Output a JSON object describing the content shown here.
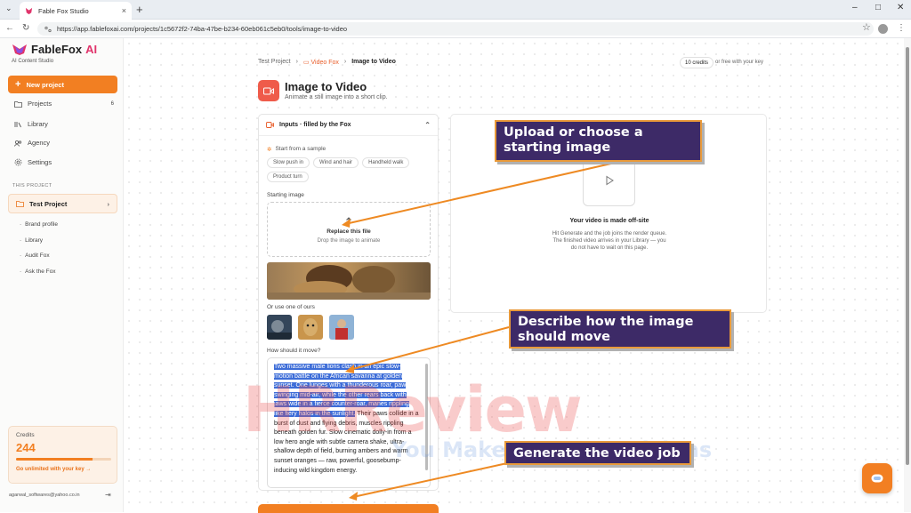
{
  "browser": {
    "tab_title": "Fable Fox Studio",
    "tab_close": "×",
    "new_tab": "+",
    "tab_list": "⌄",
    "url": "https://app.fablefoxai.com/projects/1c5672f2-74ba-47be-b234-60eb061c5eb0/tools/image-to-video",
    "min": "–",
    "max": "□",
    "close": "✕"
  },
  "sidebar": {
    "logo": "FableFox",
    "logo_ai": "AI",
    "logo_sub": "AI Content Studio",
    "new_project": "New project",
    "nav": [
      {
        "label": "Projects",
        "count": "6"
      },
      {
        "label": "Library"
      },
      {
        "label": "Agency"
      },
      {
        "label": "Settings"
      }
    ],
    "section_label": "THIS PROJECT",
    "project_name": "Test Project",
    "project_items": [
      "Brand profile",
      "Library",
      "Audit Fox",
      "Ask the Fox"
    ],
    "credits": {
      "label": "Credits",
      "value": "244",
      "fill_fraction": 0.8,
      "link": "Go unlimited with your key →"
    },
    "email": "agarwal_softwares@yahoo.co.in"
  },
  "main": {
    "breadcrumbs": [
      "Test Project",
      "Video Fox",
      "Image to Video"
    ],
    "crumb_sep": "›",
    "credits_badge": "10 credits",
    "free_key": "or free with your key",
    "title": "Image to Video",
    "subtitle": "Animate a still image into a short clip."
  },
  "inputs": {
    "header": "Inputs · filled by the Fox",
    "sample_label": "Start from a sample",
    "samples": [
      "Slow push in",
      "Wind and hair",
      "Handheld walk",
      "Product turn"
    ],
    "starting_image_label": "Starting image",
    "replace_title": "Replace this file",
    "replace_sub": "Drop the image to animate",
    "use_ours_label": "Or use one of ours",
    "move_label": "How should it move?",
    "prompt_selected": "Two massive male lions clash in an epic slow-motion battle on the African savanna at golden sunset. One lunges with a thunderous roar, paw swinging mid-air, while the other rears back with jaws wide in a fierce counter-roar, manes rippling like fiery halos in the sunlight.",
    "prompt_rest": " Their paws collide in a burst of dust and flying debris, muscles rippling beneath golden fur. Slow cinematic dolly-in from a low hero angle with subtle camera shake, ultra-shallow depth of field, burning ambers and warm sunset oranges — raw, powerful, goosebump-inducing wild kingdom energy."
  },
  "video": {
    "title": "Your video is made off-site",
    "desc": "Hit Generate and the job joins the render queue. The finished video arrives in your Library — you do not have to wait on this page."
  },
  "callouts": {
    "upload": "Upload or choose a starting image",
    "describe": "Describe how the image should move",
    "generate": "Generate the video job"
  },
  "watermark": {
    "main": "HRReview",
    "sub": "You Make Better Decisions"
  },
  "colors": {
    "accent": "#f27f22",
    "callout_bg": "#3d2a67",
    "callout_border": "#e99a3a",
    "arrow": "#ee8a23",
    "selection": "#3d6dd8"
  }
}
